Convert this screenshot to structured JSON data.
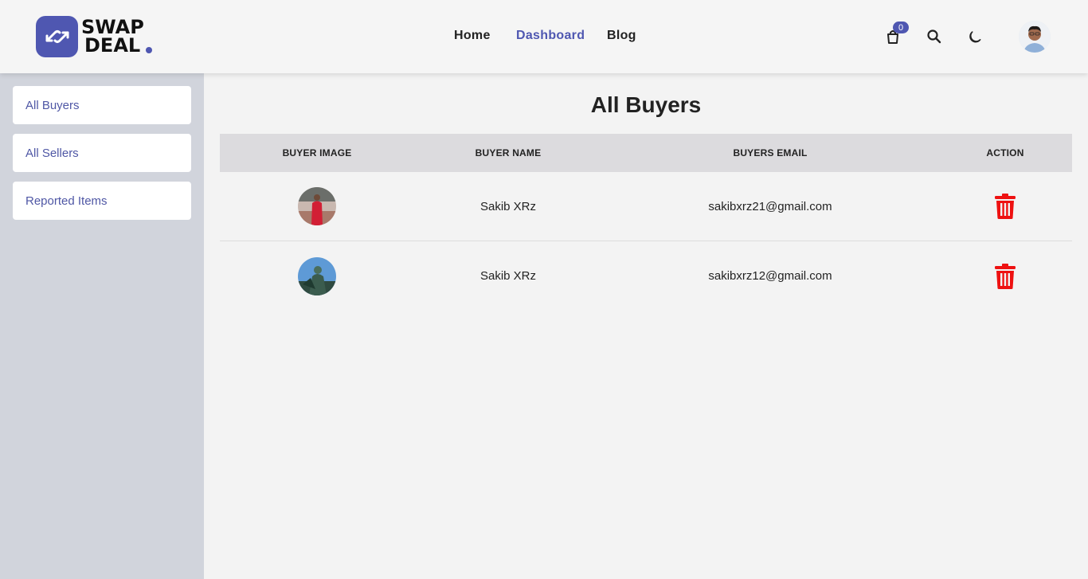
{
  "brand": {
    "line1": "SWAP",
    "line2": "DEAL"
  },
  "nav": {
    "home": "Home",
    "dashboard": "Dashboard",
    "blog": "Blog"
  },
  "header": {
    "cart_count": "0"
  },
  "sidebar": {
    "items": [
      {
        "label": "All Buyers"
      },
      {
        "label": "All Sellers"
      },
      {
        "label": "Reported Items"
      }
    ]
  },
  "main": {
    "title": "All Buyers",
    "columns": [
      "BUYER IMAGE",
      "BUYER NAME",
      "BUYERS EMAIL",
      "ACTION"
    ],
    "rows": [
      {
        "name": "Sakib XRz",
        "email": "sakibxrz21@gmail.com"
      },
      {
        "name": "Sakib XRz",
        "email": "sakibxrz12@gmail.com"
      }
    ]
  },
  "colors": {
    "accent": "#4f57b1",
    "danger": "#ee1111",
    "sidebar_bg": "#d1d4dc"
  }
}
